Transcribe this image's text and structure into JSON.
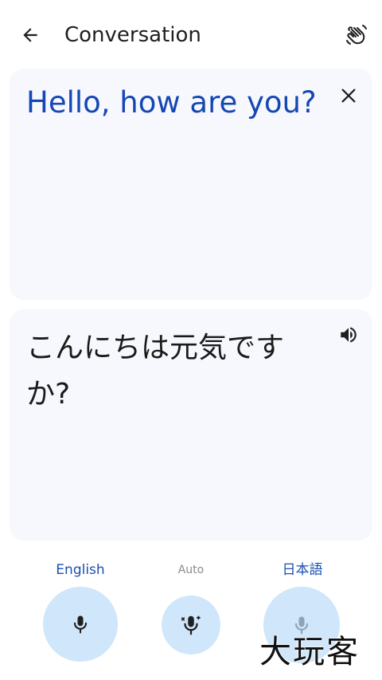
{
  "header": {
    "title": "Conversation",
    "back_icon": "arrow-left-icon",
    "wave_icon": "waving-hand-icon"
  },
  "source": {
    "text": "Hello, how are you?",
    "close_icon": "close-icon"
  },
  "target": {
    "text": "こんにちは元気ですか?",
    "speaker_icon": "speaker-icon"
  },
  "languages": {
    "left": "English",
    "middle": "Auto",
    "right": "日本語"
  },
  "mics": {
    "left_icon": "microphone-icon",
    "middle_icon": "auto-detect-microphone-icon",
    "right_icon": "microphone-icon"
  },
  "watermark": "大玩客",
  "colors": {
    "accent": "#1547b4",
    "card_bg": "#f7f8fd",
    "mic_bg": "#cfe6fb",
    "inactive": "#8a8a8a"
  }
}
